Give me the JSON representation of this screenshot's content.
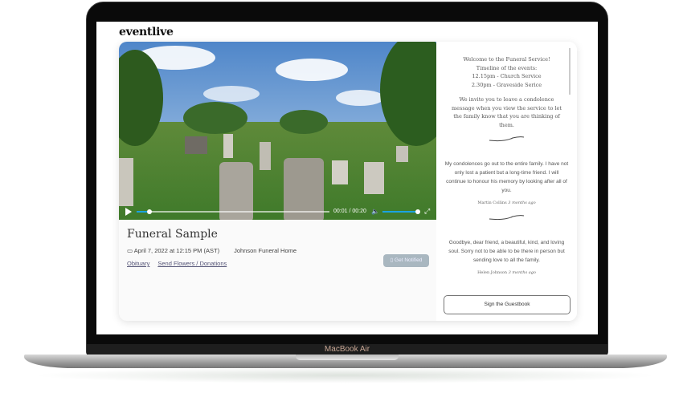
{
  "device": {
    "label": "MacBook Air"
  },
  "brand": {
    "logo": "eventlive"
  },
  "video": {
    "current_time": "00:01",
    "separator": "/",
    "duration": "00:20",
    "progress_fraction": 0.05,
    "volume_fraction": 1.0,
    "accent": "#1aa3e0"
  },
  "event": {
    "title": "Funeral Sample",
    "date": "April 7, 2022 at 12:15 PM (AST)",
    "host": "Johnson Funeral Home",
    "links": [
      "Obituary",
      "Send Flowers / Donations"
    ],
    "notify_label": "Get Notified"
  },
  "sidebar": {
    "welcome": [
      "Welcome to the Funeral Service!",
      "Timeline of the events:",
      "12.15pm - Church Service",
      "2.30pm - Graveside Serice"
    ],
    "invite": "We invite you to leave a condolence message when you view the service to let the family know that you are thinking of them.",
    "messages": [
      {
        "text": "My condolences go out to the entire family. I have not only lost a patient but a long-time friend. I will continue to honour his memory by looking after all of you.",
        "author": "Martin Collins",
        "when": "3 months ago"
      },
      {
        "text": "Goodbye, dear friend, a beautiful, kind, and loving soul. Sorry not to be able to be there in person but sending love to all the family.",
        "author": "Helen Johnson",
        "when": "3 months ago"
      }
    ],
    "guestbook_label": "Sign the Guestbook"
  }
}
